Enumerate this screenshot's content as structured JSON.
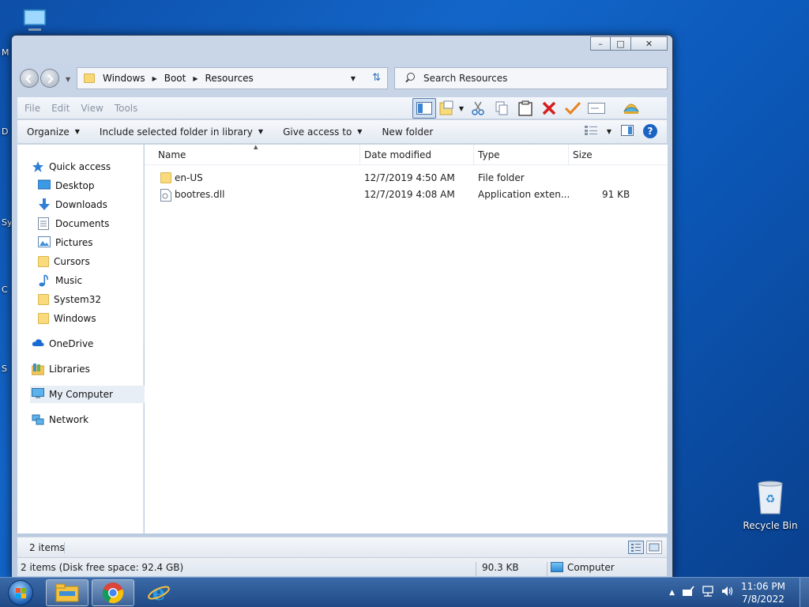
{
  "window": {
    "controls": {
      "minimize": "–",
      "maximize": "□",
      "close": "✕"
    }
  },
  "address": {
    "crumbs": [
      "Windows",
      "Boot",
      "Resources"
    ]
  },
  "search": {
    "placeholder": "Search Resources"
  },
  "menu": {
    "items": [
      "File",
      "Edit",
      "View",
      "Tools"
    ]
  },
  "commands": {
    "organize": "Organize",
    "include": "Include selected folder in library",
    "share": "Give access to",
    "new_folder": "New folder",
    "help": "?"
  },
  "navpane": {
    "quick_access": "Quick access",
    "items": [
      {
        "label": "Desktop",
        "icon": "desktop-icon",
        "pinned": true
      },
      {
        "label": "Downloads",
        "icon": "downloads-icon",
        "pinned": true
      },
      {
        "label": "Documents",
        "icon": "documents-icon",
        "pinned": true
      },
      {
        "label": "Pictures",
        "icon": "pictures-icon",
        "pinned": true
      },
      {
        "label": "Cursors",
        "icon": "folder-icon",
        "pinned": false
      },
      {
        "label": "Music",
        "icon": "music-icon",
        "pinned": false
      },
      {
        "label": "System32",
        "icon": "folder-icon",
        "pinned": false
      },
      {
        "label": "Windows",
        "icon": "folder-icon",
        "pinned": false
      }
    ],
    "onedrive": "OneDrive",
    "libraries": "Libraries",
    "computer": "My Computer",
    "network": "Network"
  },
  "filelist": {
    "columns": {
      "name": "Name",
      "date": "Date modified",
      "type": "Type",
      "size": "Size"
    },
    "rows": [
      {
        "name": "en-US",
        "date": "12/7/2019 4:50 AM",
        "type": "File folder",
        "size": "",
        "icon": "folder-icon"
      },
      {
        "name": "bootres.dll",
        "date": "12/7/2019 4:08 AM",
        "type": "Application exten...",
        "size": "91 KB",
        "icon": "dll-file-icon"
      }
    ]
  },
  "status": {
    "count": "2 items",
    "detail": "2 items (Disk free space: 92.4 GB)",
    "size": "90.3 KB",
    "location": "Computer"
  },
  "desktop": {
    "recycle_bin": "Recycle Bin",
    "edge_letters": [
      "M",
      "D",
      "Sy",
      "C",
      "S"
    ]
  },
  "taskbar": {
    "time": "11:06 PM",
    "date": "7/8/2022"
  },
  "colors": {
    "accent": "#1a63c4",
    "folder": "#f9da7c",
    "delete_red": "#d42020",
    "check_orange": "#e8821e"
  }
}
